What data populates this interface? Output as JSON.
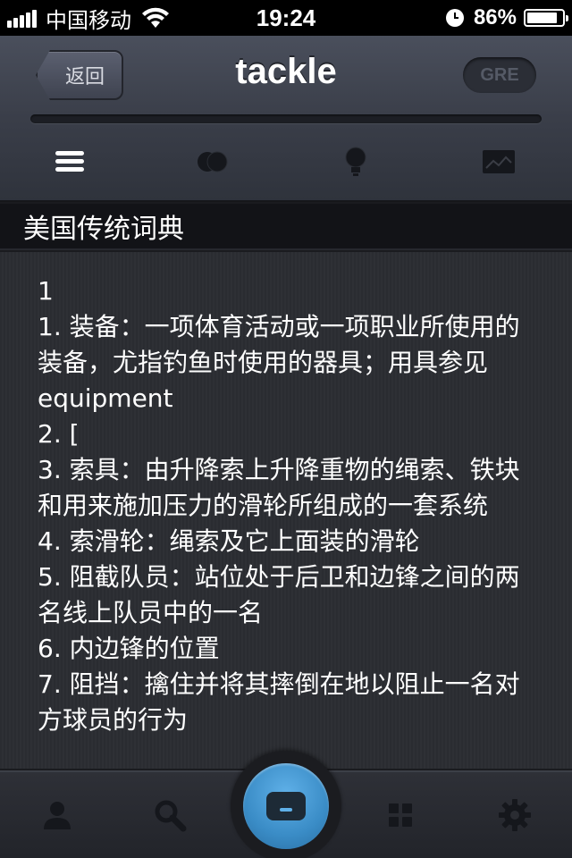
{
  "status_bar": {
    "carrier": "中国移动",
    "time": "19:24",
    "battery_percent": "86%",
    "battery_level": 0.86,
    "icons": [
      "signal-icon",
      "wifi-icon",
      "clock-icon",
      "battery-icon"
    ]
  },
  "header": {
    "back_label": "返回",
    "title": "tackle",
    "badge": "GRE",
    "tabs": [
      "list-icon",
      "circles-icon",
      "lightbulb-icon",
      "chart-icon"
    ]
  },
  "section": {
    "title": "美国传统词典"
  },
  "definitions": [
    "1",
    "1. 装备：一项体育活动或一项职业所使用的装备，尤指钓鱼时使用的器具；用具参见 equipment",
    "2. [",
    "3. 索具：由升降索上升降重物的绳索、铁块和用来施加压力的滑轮所组成的一套系统",
    "4. 索滑轮：绳索及它上面装的滑轮",
    "5. 阻截队员：站位处于后卫和边锋之间的两名线上队员中的一名",
    "6. 内边锋的位置",
    "7. 阻挡：擒住并将其摔倒在地以阻止一名对方球员的行为"
  ],
  "tabbar": {
    "items": [
      "person-icon",
      "search-icon",
      "card-icon",
      "grid-icon",
      "gear-icon"
    ]
  },
  "colors": {
    "accent_blue": "#3a8cc6",
    "content_bg": "#2c2e33",
    "header_bg": "#3a3e49"
  }
}
